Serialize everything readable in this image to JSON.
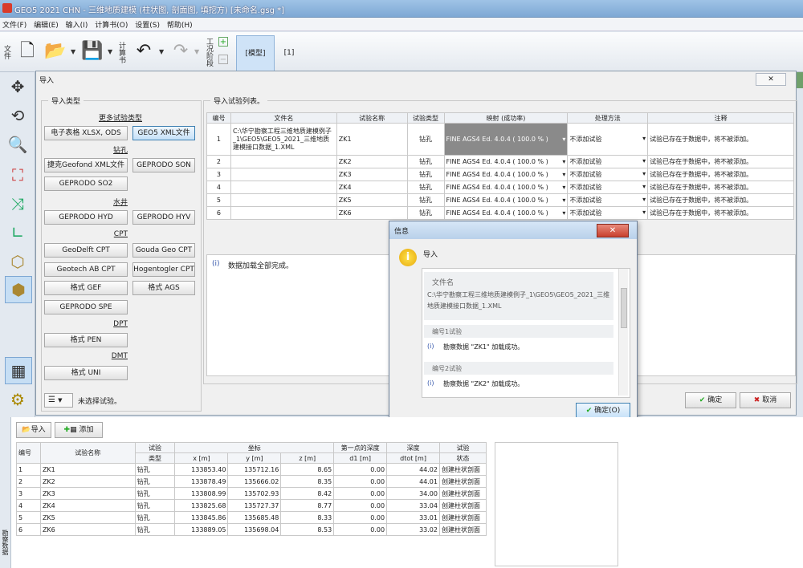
{
  "window": {
    "title": "GEO5 2021 CHN - 三维地质建模 (柱状图, 剖面图, 填挖方) [未命名.gsg *]"
  },
  "menu": [
    "文件(F)",
    "编辑(E)",
    "输入(I)",
    "计算书(O)",
    "设置(S)",
    "帮助(H)"
  ],
  "toolbar": {
    "file_label": "文件",
    "report_label": "计算书",
    "outline_label": "工况阶段",
    "tab_model": "[模型]",
    "tab_1": "[1]"
  },
  "import_dialog": {
    "title": "导入",
    "close": "✕",
    "types_group": "导入类型",
    "list_group": "导入试验列表。",
    "more_types": "更多试验类型",
    "buttons": {
      "xlsx": "电子表格 XLSX, ODS",
      "geo5xml": "GEO5 XML文件",
      "geofond": "捷克Geofond XML文件",
      "geprodo_son": "GEPRODO SON",
      "geprodo_so2": "GEPRODO SO2",
      "geprodo_hyd": "GEPRODO HYD",
      "geprodo_hyv": "GEPRODO HYV",
      "geodelft": "GeoDelft CPT",
      "gouda": "Gouda Geo CPT",
      "geotech": "Geotech AB CPT",
      "hogentogler": "Hogentogler CPT",
      "gef": "格式 GEF",
      "ags": "格式 AGS",
      "geprodo_spe": "GEPRODO SPE",
      "pen": "格式 PEN",
      "uni": "格式 UNI"
    },
    "categories": {
      "borehole": "钻孔",
      "well": "水井",
      "cpt": "CPT",
      "dpt": "DPT",
      "dmt": "DMT"
    },
    "table": {
      "headers": [
        "编号",
        "文件名",
        "试验名称",
        "试验类型",
        "映射 (成功率)",
        "处理方法",
        "注释"
      ],
      "rows": [
        {
          "no": "1",
          "file": "C:\\华宁勘察工程三维地质建模例子_1\\GEO5\\GEO5_2021_三维地质建模接口数据_1.XML",
          "name": "ZK1",
          "type": "钻孔",
          "map": "FINE AGS4 Ed. 4.0.4 ( 100.0 % )",
          "method": "不添加试验",
          "note": "试验已存在于数据中，将不被添加。"
        },
        {
          "no": "2",
          "file": "",
          "name": "ZK2",
          "type": "钻孔",
          "map": "FINE AGS4 Ed. 4.0.4 ( 100.0 % )",
          "method": "不添加试验",
          "note": "试验已存在于数据中，将不被添加。"
        },
        {
          "no": "3",
          "file": "",
          "name": "ZK3",
          "type": "钻孔",
          "map": "FINE AGS4 Ed. 4.0.4 ( 100.0 % )",
          "method": "不添加试验",
          "note": "试验已存在于数据中，将不被添加。"
        },
        {
          "no": "4",
          "file": "",
          "name": "ZK4",
          "type": "钻孔",
          "map": "FINE AGS4 Ed. 4.0.4 ( 100.0 % )",
          "method": "不添加试验",
          "note": "试验已存在于数据中，将不被添加。"
        },
        {
          "no": "5",
          "file": "",
          "name": "ZK5",
          "type": "钻孔",
          "map": "FINE AGS4 Ed. 4.0.4 ( 100.0 % )",
          "method": "不添加试验",
          "note": "试验已存在于数据中，将不被添加。"
        },
        {
          "no": "6",
          "file": "",
          "name": "ZK6",
          "type": "钻孔",
          "map": "FINE AGS4 Ed. 4.0.4 ( 100.0 % )",
          "method": "不添加试验",
          "note": "试验已存在于数据中，将不被添加。"
        }
      ]
    },
    "message": "数据加载全部完成。",
    "no_selection": "未选择试验。",
    "ok": "确定",
    "cancel": "取消"
  },
  "info_dialog": {
    "title": "信息",
    "heading": "导入",
    "file_label": "文件名",
    "file_path": "C:\\华宁勘察工程三维地质建模例子_1\\GEO5\\GEO5_2021_三维地质建模接口数据_1.XML",
    "test1_label": "编号1试验",
    "test1_msg": "勘察数据 \"ZK1\" 加载成功。",
    "test2_label": "编号2试验",
    "test2_msg": "勘察数据 \"ZK2\" 加载成功。",
    "ok": "确定(O)"
  },
  "bottom": {
    "import_btn": "导入",
    "add_btn": "添加",
    "side_label": "勘察数据",
    "headers": {
      "no": "编号",
      "name": "试验名称",
      "type1": "试验",
      "type2": "类型",
      "coord": "坐标",
      "x": "x [m]",
      "y": "y [m]",
      "z": "z [m]",
      "d1a": "第一点的深度",
      "d1b": "d1 [m]",
      "depa": "深度",
      "depb": "dtot [m]",
      "state1": "试验",
      "state2": "状态"
    },
    "rows": [
      {
        "no": "1",
        "name": "ZK1",
        "type": "钻孔",
        "x": "133853.40",
        "y": "135712.16",
        "z": "8.65",
        "d1": "0.00",
        "dtot": "44.02",
        "state": "创建柱状剖面"
      },
      {
        "no": "2",
        "name": "ZK2",
        "type": "钻孔",
        "x": "133878.49",
        "y": "135666.02",
        "z": "8.35",
        "d1": "0.00",
        "dtot": "44.01",
        "state": "创建柱状剖面"
      },
      {
        "no": "3",
        "name": "ZK3",
        "type": "钻孔",
        "x": "133808.99",
        "y": "135702.93",
        "z": "8.42",
        "d1": "0.00",
        "dtot": "34.00",
        "state": "创建柱状剖面"
      },
      {
        "no": "4",
        "name": "ZK4",
        "type": "钻孔",
        "x": "133825.68",
        "y": "135727.37",
        "z": "8.77",
        "d1": "0.00",
        "dtot": "33.04",
        "state": "创建柱状剖面"
      },
      {
        "no": "5",
        "name": "ZK5",
        "type": "钻孔",
        "x": "133845.86",
        "y": "135685.48",
        "z": "8.33",
        "d1": "0.00",
        "dtot": "33.01",
        "state": "创建柱状剖面"
      },
      {
        "no": "6",
        "name": "ZK6",
        "type": "钻孔",
        "x": "133889.05",
        "y": "135698.04",
        "z": "8.53",
        "d1": "0.00",
        "dtot": "33.02",
        "state": "创建柱状剖面"
      }
    ]
  }
}
